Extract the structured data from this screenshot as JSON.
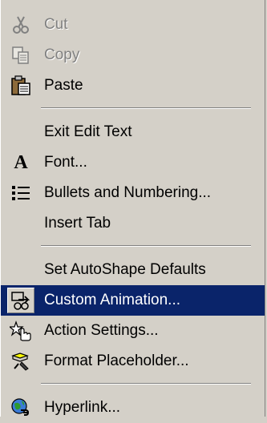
{
  "menu": {
    "cut": "Cut",
    "copy": "Copy",
    "paste": "Paste",
    "exit_edit_text": "Exit Edit Text",
    "font": "Font...",
    "bullets": "Bullets and Numbering...",
    "insert_tab": "Insert Tab",
    "autoshape_defaults": "Set AutoShape Defaults",
    "custom_animation": "Custom Animation...",
    "action_settings": "Action Settings...",
    "format_placeholder": "Format Placeholder...",
    "hyperlink": "Hyperlink..."
  },
  "icons": {
    "cut": "scissors-icon",
    "copy": "copy-icon",
    "paste": "clipboard-icon",
    "font": "font-A-icon",
    "bullets": "bullet-list-icon",
    "custom_animation": "animation-icon",
    "action_settings": "hand-pointer-icon",
    "format_placeholder": "format-brush-icon",
    "hyperlink": "globe-link-icon"
  },
  "colors": {
    "menu_bg": "#d4d0c8",
    "highlight": "#0a246a",
    "disabled_text": "#808080"
  }
}
